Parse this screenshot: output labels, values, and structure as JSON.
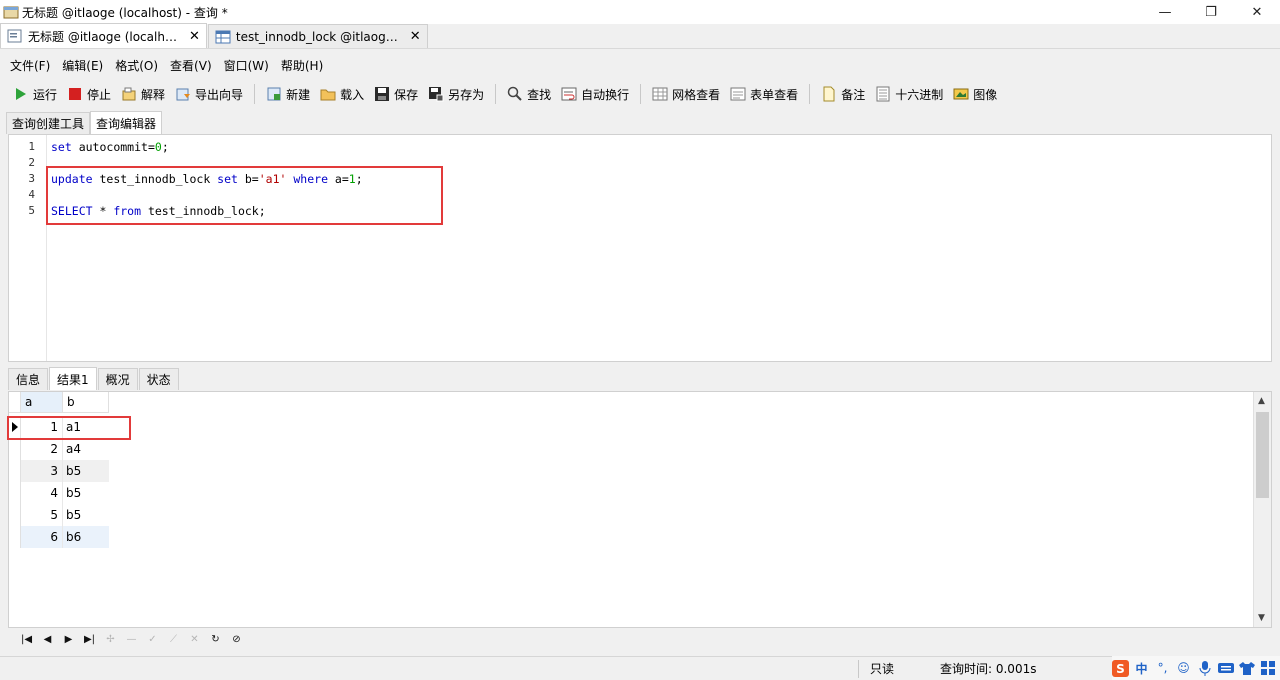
{
  "window": {
    "title": "无标题 @itlaoge (localhost) - 查询 *"
  },
  "doc_tabs": [
    {
      "label": "无标题 @itlaoge (localh…",
      "close": "✕"
    },
    {
      "label": "test_innodb_lock @itlaog…",
      "close": "✕"
    }
  ],
  "menu": [
    "文件(F)",
    "编辑(E)",
    "格式(O)",
    "查看(V)",
    "窗口(W)",
    "帮助(H)"
  ],
  "toolbar": {
    "run": "运行",
    "stop": "停止",
    "explain": "解释",
    "export_wizard": "导出向导",
    "new": "新建",
    "load": "载入",
    "save": "保存",
    "save_as": "另存为",
    "find": "查找",
    "word_wrap": "自动换行",
    "grid_view": "网格查看",
    "form_view": "表单查看",
    "memo": "备注",
    "hex": "十六进制",
    "image": "图像"
  },
  "sub_tabs": [
    "查询创建工具",
    "查询编辑器"
  ],
  "editor": {
    "line_numbers": [
      "1",
      "2",
      "3",
      "4",
      "5"
    ]
  },
  "result_tabs": [
    "信息",
    "结果1",
    "概况",
    "状态"
  ],
  "grid": {
    "columns": [
      "a",
      "b"
    ],
    "rows": [
      [
        "1",
        "a1"
      ],
      [
        "2",
        "a4"
      ],
      [
        "3",
        "b5"
      ],
      [
        "4",
        "b5"
      ],
      [
        "5",
        "b5"
      ],
      [
        "6",
        "b6"
      ]
    ]
  },
  "status": {
    "readonly": "只读",
    "query_time": "查询时间: 0.001s"
  },
  "ime": {
    "mode": "中"
  },
  "colors": {
    "highlight_box": "#e23a3a",
    "keyword": "#0000c8",
    "number": "#00a000",
    "string": "#b00000"
  }
}
